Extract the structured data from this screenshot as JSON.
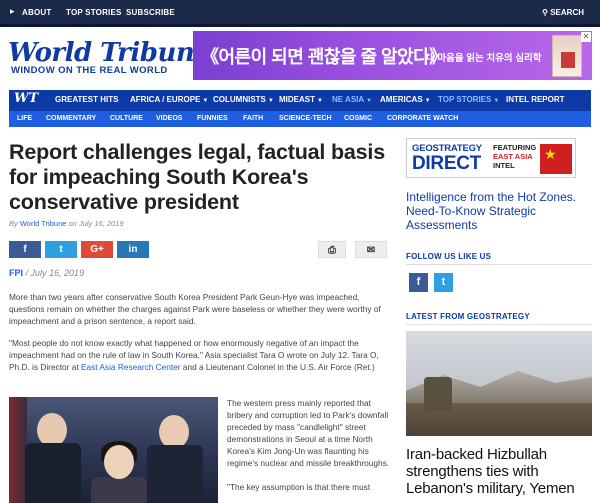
{
  "topbar": {
    "about": "ABOUT",
    "top_stories": "TOP STORIES",
    "subscribe": "SUBSCRIBE",
    "search": "SEARCH"
  },
  "header": {
    "logo": "World Tribune",
    "tagline": "WINDOW ON THE REAL WORLD",
    "ad_text": "《어른이 되면 괜찮을 줄 알았다》",
    "ad_sub": "내 마음을 읽는 치유의 심리학"
  },
  "mainnav": {
    "mark": "WT",
    "items": [
      {
        "label": "GREATEST HITS",
        "caret": ""
      },
      {
        "label": "AFRICA / EUROPE",
        "caret": "▼"
      },
      {
        "label": "COLUMNISTS",
        "caret": "▼"
      },
      {
        "label": "MIDEAST",
        "caret": "▼"
      },
      {
        "label": "NE ASIA",
        "caret": "▼"
      },
      {
        "label": "AMERICAS",
        "caret": "▼"
      },
      {
        "label": "TOP STORIES",
        "caret": "▼"
      },
      {
        "label": "INTEL REPORT",
        "caret": ""
      }
    ]
  },
  "subnav": {
    "items": [
      "LIFE",
      "COMMENTARY",
      "CULTURE",
      "VIDEOS",
      "FUNNIES",
      "FAITH",
      "SCIENCE-TECH",
      "COSMIC",
      "CORPORATE WATCH"
    ]
  },
  "article": {
    "title": "Report challenges legal, factual basis for impeaching South Korea's conservative president",
    "by": "By",
    "author": "World Tribune",
    "on_date": "on July 16, 2019",
    "share": {
      "fb": "f",
      "tw": "t",
      "gp": "G+",
      "li": "in",
      "print": "⎙",
      "mail": "✉"
    },
    "source": "FPI",
    "dateline": "/ July 16, 2019",
    "p1": "More than two years after conservative South Korea President Park Geun-Hye was impeached, questions remain on whether the charges against Park were baseless or whether they were worthy of impeachment and a prison sentence, a report said.",
    "p2_a": "\"Most people do not know exactly what happened or how enormously negative of an impact the impeachment had on the rule of law in South Korea,\" Asia specialist Tara O wrote on July 12. Tara O, Ph.D. is Director at ",
    "p2_link": "East Asia Research Center",
    "p2_b": " and a Lieutenant Colonel in the U.S. Air Force (Ret.)",
    "p3": "The western press mainly reported that bribery and corruption led to Park's downfall preceded by mass \"candlelight\" street demonstrations in Seoul at a time North Korea's Kim Jong-Un was flaunting his regime's nuclear and missile breakthroughs.",
    "p4": "\"The key assumption is that there must"
  },
  "sidebar": {
    "gs_top": "GEOSTRATEGY",
    "gs_big": "DIRECT",
    "gs_side_1": "FEATURING",
    "gs_side_2": "EAST ASIA",
    "gs_side_3": "INTEL",
    "gs_flag": "★",
    "gs_caption": "Intelligence from the Hot Zones. Need-To-Know Strategic Assessments",
    "follow_head": "FOLLOW US LIKE US",
    "follow_fb": "f",
    "follow_tw": "t",
    "latest_head": "LATEST FROM GEOSTRATEGY",
    "latest_headline": "Iran-backed Hizbullah strengthens ties with Lebanon's military, Yemen"
  },
  "colors": {
    "brand_blue": "#0d3aa6",
    "subnav_blue": "#1f5ee0",
    "topbar": "#1b2a48",
    "active_nav": "#7fc3ff"
  }
}
